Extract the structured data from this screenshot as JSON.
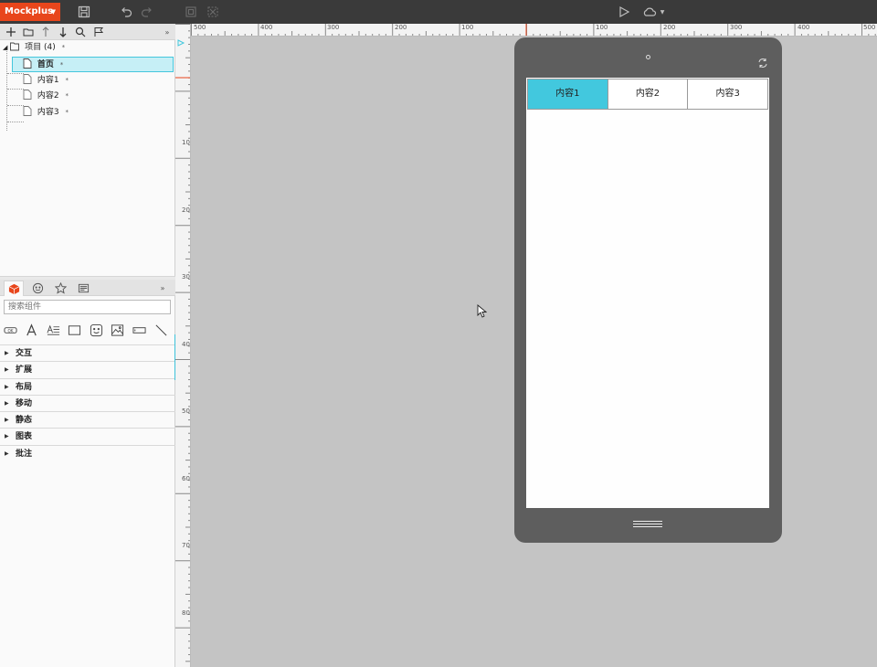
{
  "app": {
    "name": "Mockplus"
  },
  "toolbar": {
    "icons": [
      "save-icon",
      "undo-icon",
      "redo-icon",
      "group-icon",
      "ungroup-icon",
      "play-icon",
      "cloud-icon"
    ]
  },
  "project_panel": {
    "tools": [
      "add-icon",
      "folder-icon",
      "move-up-icon",
      "move-down-icon",
      "search-icon",
      "flag-icon"
    ],
    "tree": {
      "root": {
        "label": "项目 (4)",
        "mark": "*"
      },
      "pages": [
        {
          "label": "首页",
          "mark": "*",
          "selected": true
        },
        {
          "label": "内容1",
          "mark": "*"
        },
        {
          "label": "内容2",
          "mark": "*"
        },
        {
          "label": "内容3",
          "mark": "*"
        }
      ]
    }
  },
  "components_panel": {
    "search_placeholder": "搜索组件",
    "widgets": [
      "button-widget-icon",
      "text-widget-icon",
      "paragraph-widget-icon",
      "rectangle-widget-icon",
      "emoji-widget-icon",
      "image-widget-icon",
      "textbox-widget-icon",
      "line-widget-icon"
    ],
    "button_widget_text": "OK",
    "categories": [
      "交互",
      "扩展",
      "布局",
      "移动",
      "静态",
      "图表",
      "批注"
    ]
  },
  "rulers": {
    "horizontal": [
      "500",
      "400",
      "300",
      "200",
      "100",
      "100",
      "200",
      "300",
      "400",
      "500"
    ],
    "vertical": [
      "100",
      "200",
      "300",
      "400",
      "500",
      "600",
      "700",
      "800"
    ]
  },
  "device": {
    "tabs": [
      {
        "label": "内容1",
        "active": true
      },
      {
        "label": "内容2",
        "active": false
      },
      {
        "label": "内容3",
        "active": false
      }
    ]
  },
  "colors": {
    "brand": "#e8461c",
    "accent": "#42c8de",
    "selection": "#c6eff6"
  }
}
